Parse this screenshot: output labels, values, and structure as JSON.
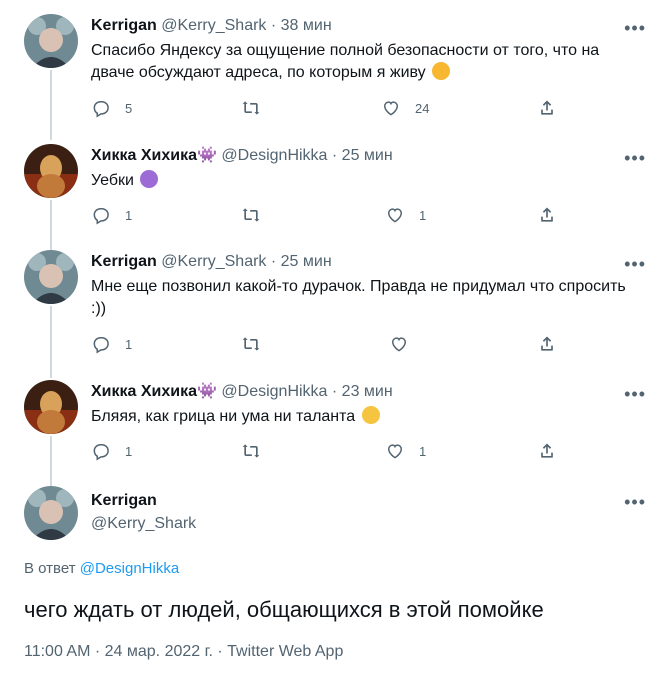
{
  "tweets": [
    {
      "name": "Kerrigan",
      "handle": "@Kerry_Shark",
      "time": "· 38 мин",
      "text": "Спасибо Яндексу за ощущение полной безопасности от того, что на дваче обсуждают адреса, по которым я живу",
      "replies": "5",
      "retweets": "",
      "likes": "24"
    },
    {
      "name": "Хикка Хихика",
      "handle": "@DesignHikka",
      "time": "· 25 мин",
      "text": "Уебки",
      "replies": "1",
      "retweets": "",
      "likes": "1"
    },
    {
      "name": "Kerrigan",
      "handle": "@Kerry_Shark",
      "time": "· 25 мин",
      "text": "Мне еще позвонил какой-то дурачок. Правда не придумал что спросить :))",
      "replies": "1",
      "retweets": "",
      "likes": ""
    },
    {
      "name": "Хикка Хихика",
      "handle": "@DesignHikka",
      "time": "· 23 мин",
      "text": "Бляяя, как грица ни ума ни таланта",
      "replies": "1",
      "retweets": "",
      "likes": "1"
    }
  ],
  "main_tweet": {
    "name": "Kerrigan",
    "handle": "@Kerry_Shark",
    "reply_prefix": "В ответ",
    "reply_to": "@DesignHikka",
    "text": "чего ждать от людей, общающихся в этой помойке",
    "timestamp": "11:00 AM · 24 мар. 2022 г. · Twitter Web App"
  },
  "more_label": "•••",
  "colors": {
    "accent": "#1d9bf0",
    "secondary": "#536471",
    "line": "#cfd9de"
  }
}
